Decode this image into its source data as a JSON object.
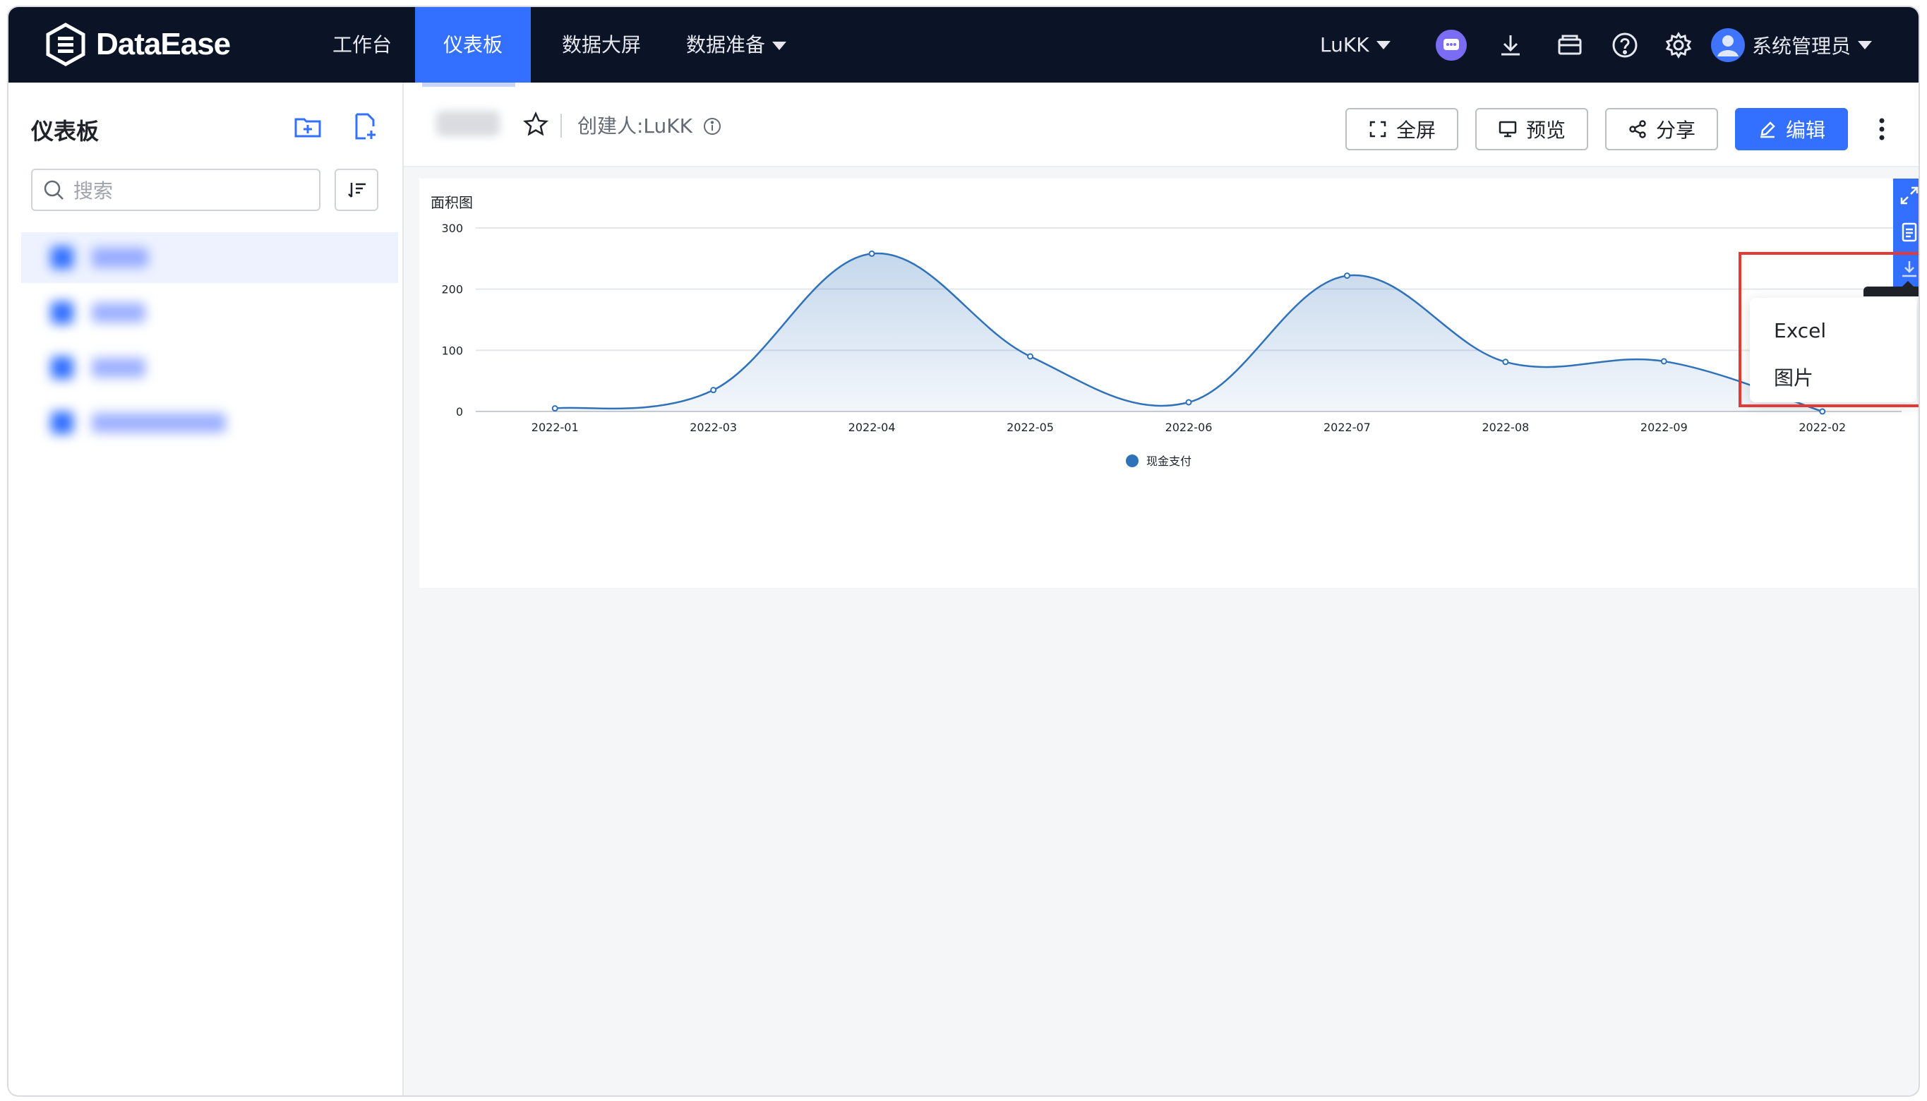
{
  "app": {
    "logo_text": "DataEase",
    "nav": [
      {
        "label": "工作台"
      },
      {
        "label": "仪表板"
      },
      {
        "label": "数据大屏"
      },
      {
        "label": "数据准备"
      }
    ],
    "org_label": "LuKK",
    "user_label": "系统管理员",
    "colors": {
      "nav_bg": "#0b1326",
      "accent": "#3370ff"
    }
  },
  "sidebar": {
    "title": "仪表板",
    "search_placeholder": "搜索",
    "icons": [
      "folder-add-icon",
      "file-add-icon",
      "sort-icon"
    ]
  },
  "header": {
    "creator": "创建人:LuKK",
    "buttons": {
      "fullscreen": "全屏",
      "preview": "预览",
      "share": "分享",
      "edit": "编辑"
    }
  },
  "download_menu": {
    "options": [
      "Excel",
      "图片"
    ]
  },
  "chart_data": {
    "type": "area",
    "title": "面积图",
    "categories": [
      "2022-01",
      "2022-03",
      "2022-04",
      "2022-05",
      "2022-06",
      "2022-07",
      "2022-08",
      "2022-09",
      "2022-02"
    ],
    "series": [
      {
        "name": "现金支付",
        "values": [
          5,
          35,
          258,
          90,
          15,
          222,
          81,
          82,
          0
        ]
      }
    ],
    "ylim": [
      0,
      300
    ],
    "yticks": [
      "300",
      "200",
      "100",
      "0"
    ],
    "grid": true,
    "legend_position": "bottom-center",
    "color": "#2f72ba"
  }
}
